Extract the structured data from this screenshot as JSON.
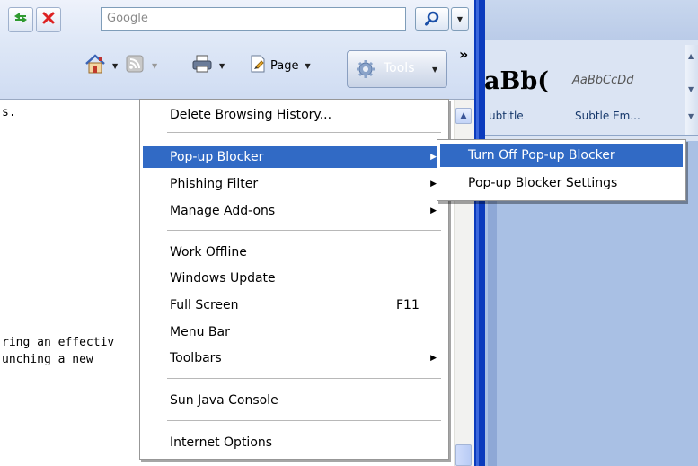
{
  "toolbar": {
    "search_placeholder": "Google",
    "page_label": "Page",
    "tools_label": "Tools",
    "more_chevron": "»"
  },
  "page_text": {
    "line1": "s.",
    "line2": "ring an effectiv",
    "line3": "unching a new"
  },
  "word_styles": {
    "heading_sample": "aBb(",
    "subtle_sample": "AaBbCcDd",
    "subtitle_label": "ubtitle",
    "subtle_label": "Subtle Em..."
  },
  "tools_menu": {
    "delete_history": "Delete Browsing History...",
    "popup_blocker": "Pop-up Blocker",
    "phishing_filter": "Phishing Filter",
    "manage_addons": "Manage Add-ons",
    "work_offline": "Work Offline",
    "windows_update": "Windows Update",
    "full_screen": "Full Screen",
    "full_screen_shortcut": "F11",
    "menu_bar": "Menu Bar",
    "toolbars": "Toolbars",
    "sun_java": "Sun Java Console",
    "internet_options": "Internet Options"
  },
  "popup_submenu": {
    "turn_off": "Turn Off Pop-up Blocker",
    "settings": "Pop-up Blocker Settings"
  },
  "colors": {
    "menu_highlight": "#316ac5",
    "frame_blue": "#0b3bbd"
  }
}
